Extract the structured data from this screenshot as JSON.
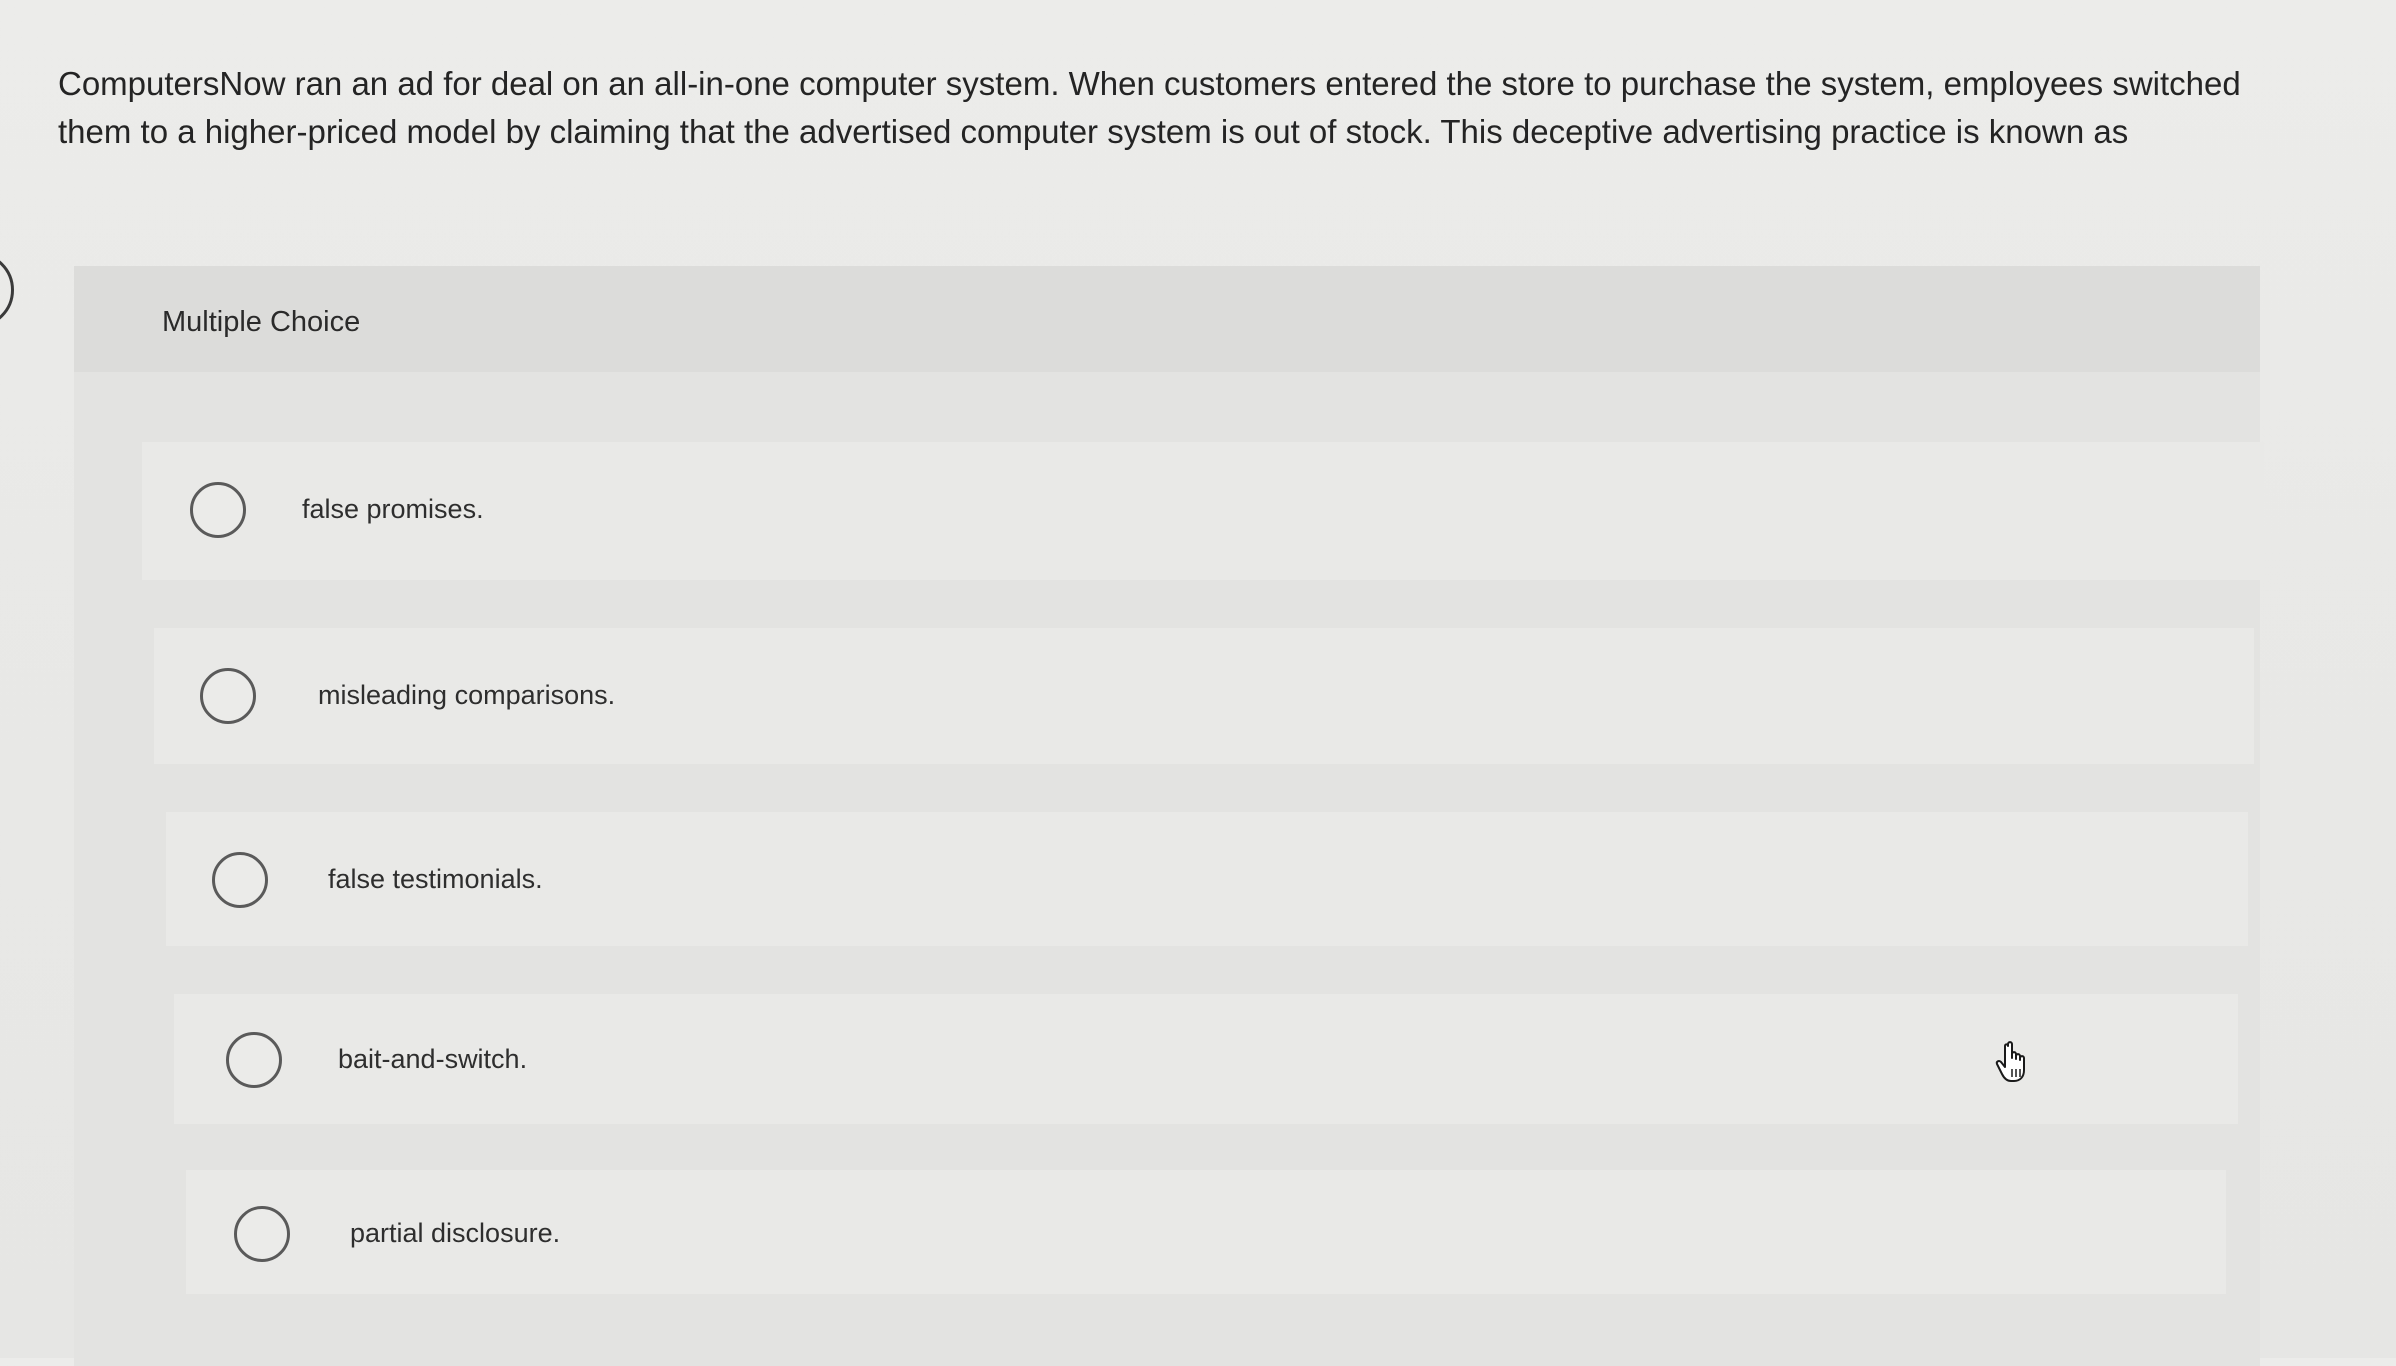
{
  "question": {
    "text": "ComputersNow ran an ad for deal on an all-in-one computer system. When customers entered the store to purchase the system, employees switched them to a higher-priced model by claiming that the advertised computer system is out of stock. This deceptive advertising practice is known as"
  },
  "panel": {
    "header_label": "Multiple Choice"
  },
  "options": [
    {
      "label": "false promises.",
      "selected": false
    },
    {
      "label": "misleading comparisons.",
      "selected": false
    },
    {
      "label": "false testimonials.",
      "selected": false
    },
    {
      "label": "bait-and-switch.",
      "selected": false
    },
    {
      "label": "partial disclosure.",
      "selected": false
    }
  ],
  "icons": {
    "radio": "radio-empty-icon",
    "cursor": "hand-pointer-icon",
    "side_tab": "side-tab-handle-icon"
  }
}
